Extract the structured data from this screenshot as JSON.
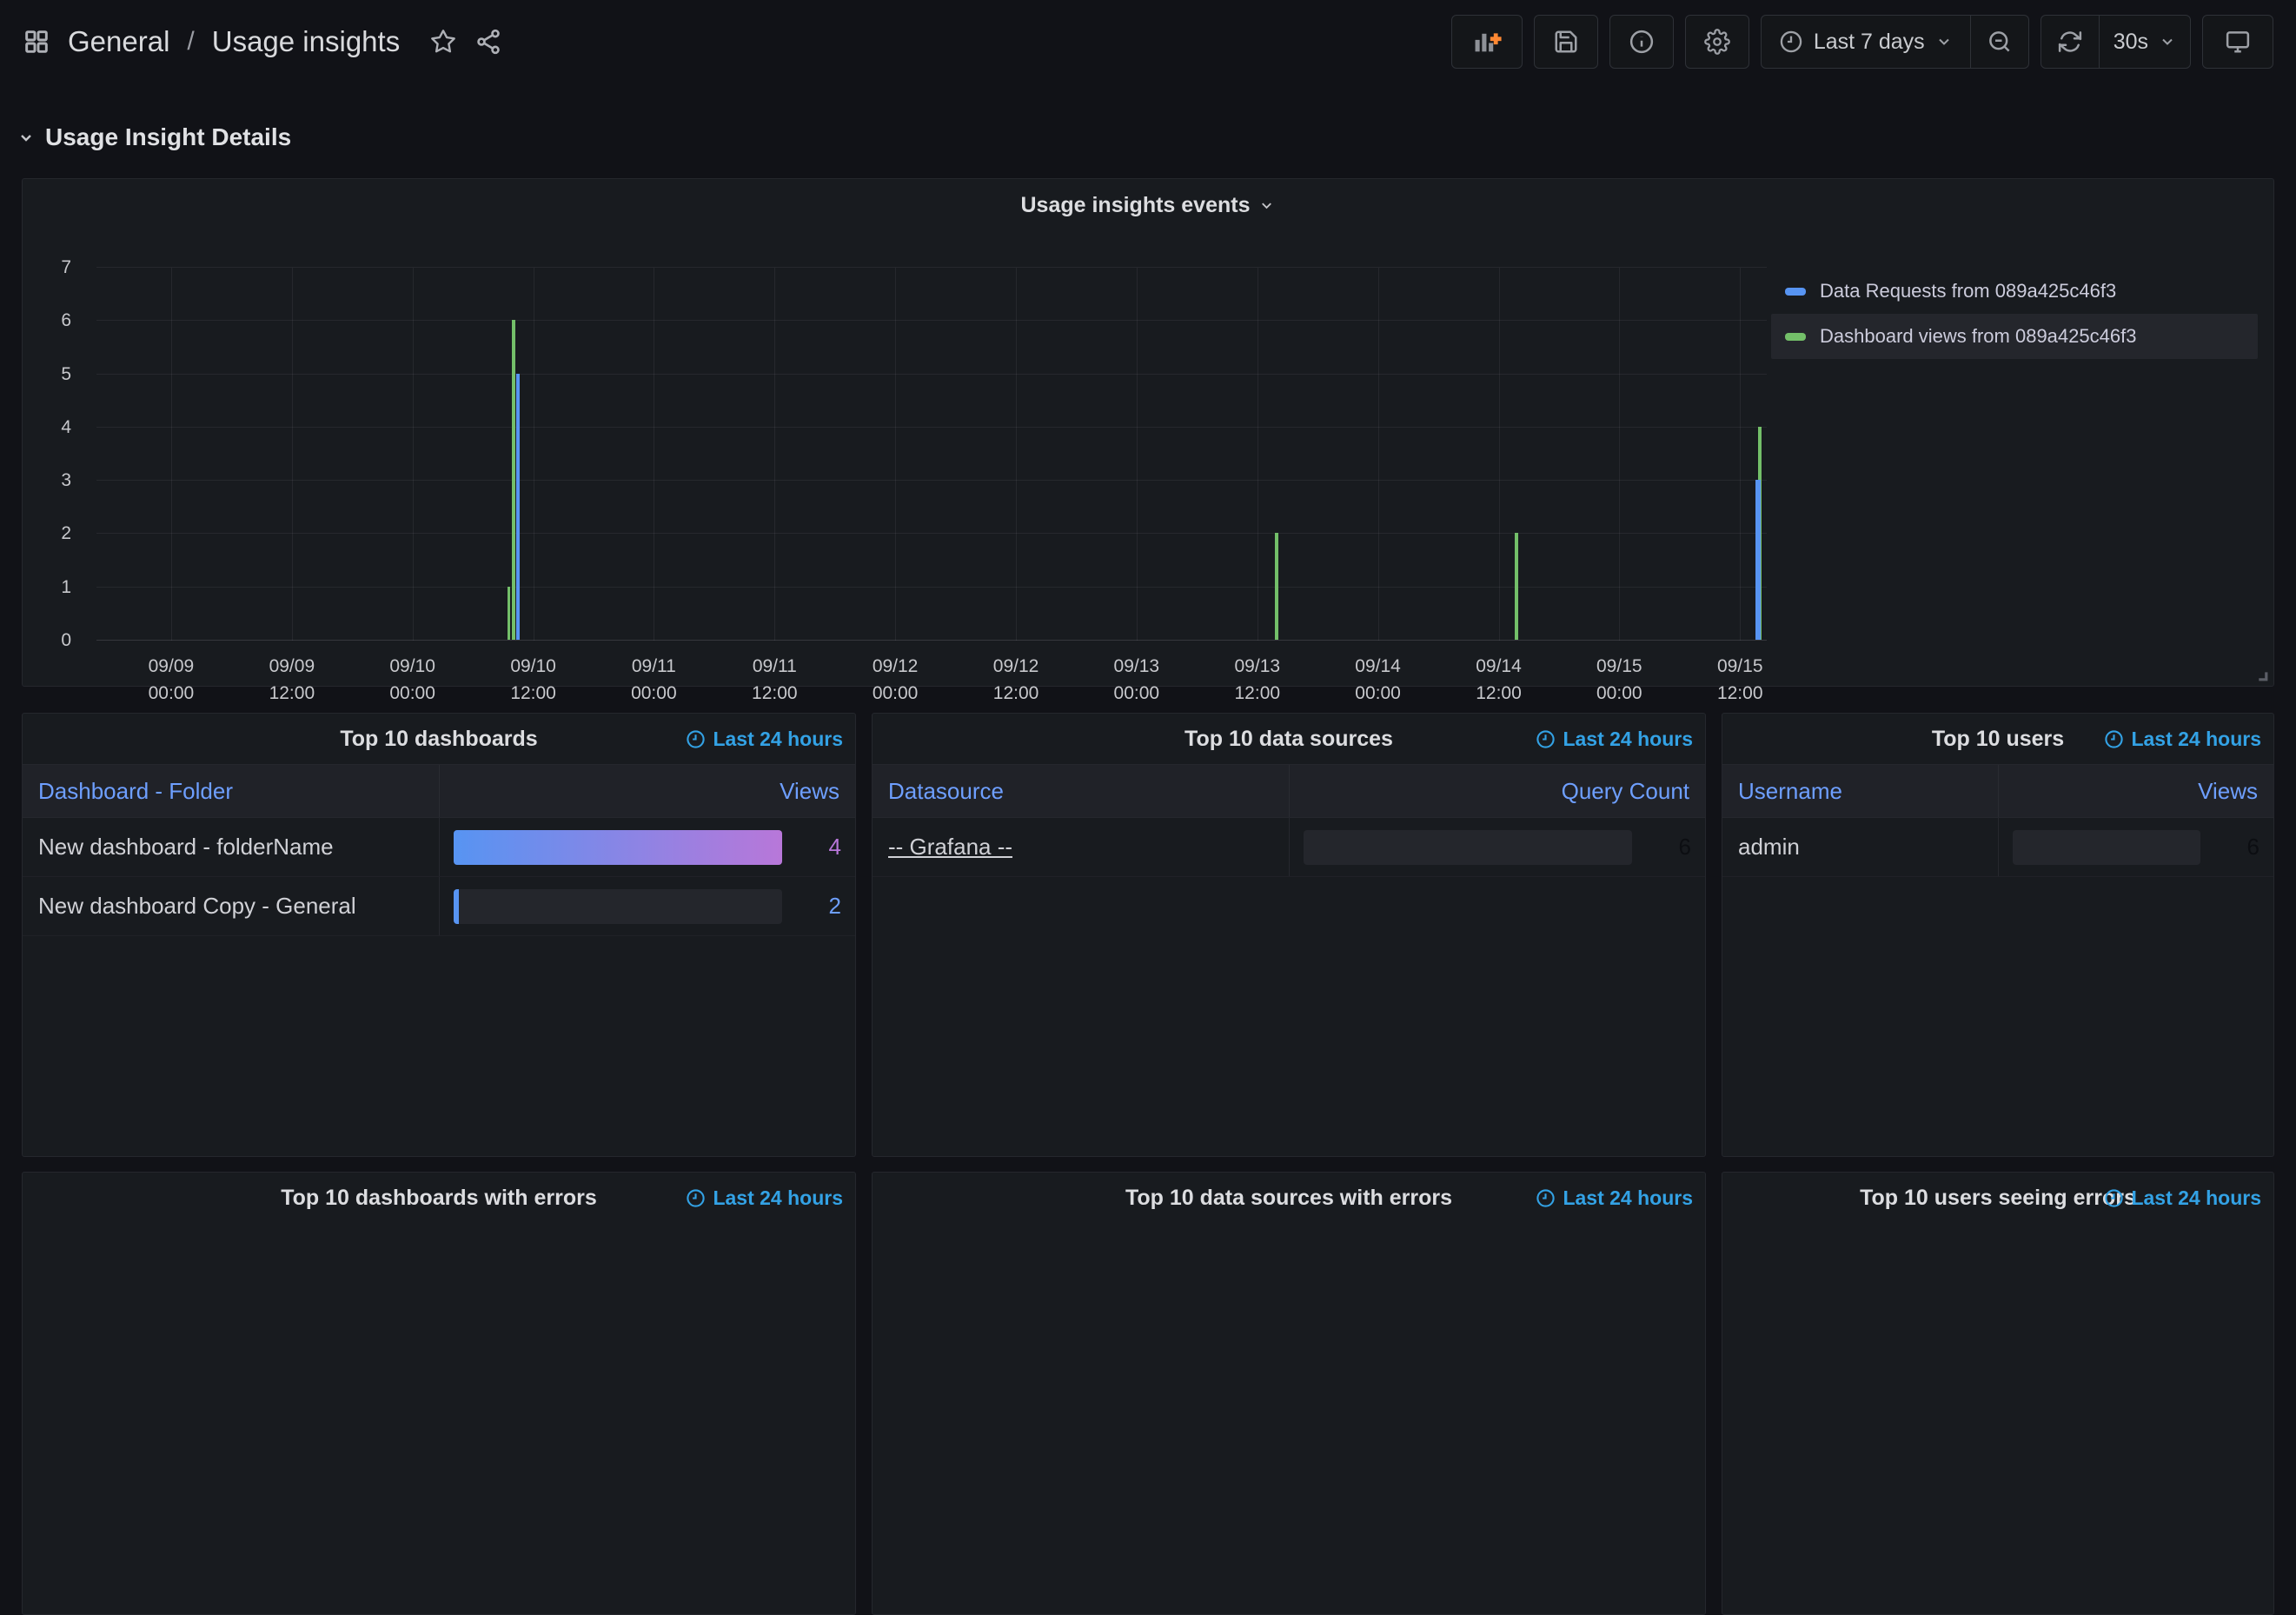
{
  "breadcrumb": {
    "section": "General",
    "separator": "/",
    "page": "Usage insights"
  },
  "toolbar": {
    "time_range_label": "Last 7 days",
    "refresh_interval": "30s"
  },
  "section_header": {
    "title": "Usage Insight Details"
  },
  "colors": {
    "data_requests": "#5794F2",
    "dashboard_views": "#73BF69",
    "gradient_start": "#5794F2",
    "gradient_end": "#B877D9",
    "accent_blue": "#33A2E5",
    "link_blue": "#6E9FFF",
    "dark_value": "#0C0E12",
    "orange_plus": "#FF8833"
  },
  "chart": {
    "title": "Usage insights events",
    "y_max": 7,
    "y_ticks": [
      7,
      6,
      5,
      4,
      3,
      2,
      1,
      0
    ],
    "x_ticks": [
      {
        "frac": 0.0447,
        "date": "09/09",
        "time": "00:00"
      },
      {
        "frac": 0.117,
        "date": "09/09",
        "time": "12:00"
      },
      {
        "frac": 0.1892,
        "date": "09/10",
        "time": "00:00"
      },
      {
        "frac": 0.2615,
        "date": "09/10",
        "time": "12:00"
      },
      {
        "frac": 0.3337,
        "date": "09/11",
        "time": "00:00"
      },
      {
        "frac": 0.406,
        "date": "09/11",
        "time": "12:00"
      },
      {
        "frac": 0.4782,
        "date": "09/12",
        "time": "00:00"
      },
      {
        "frac": 0.5505,
        "date": "09/12",
        "time": "12:00"
      },
      {
        "frac": 0.6227,
        "date": "09/13",
        "time": "00:00"
      },
      {
        "frac": 0.695,
        "date": "09/13",
        "time": "12:00"
      },
      {
        "frac": 0.7672,
        "date": "09/14",
        "time": "00:00"
      },
      {
        "frac": 0.8395,
        "date": "09/14",
        "time": "12:00"
      },
      {
        "frac": 0.9117,
        "date": "09/15",
        "time": "00:00"
      },
      {
        "frac": 0.984,
        "date": "09/15",
        "time": "12:00"
      }
    ],
    "bars": [
      {
        "frac": 0.247,
        "value": 1,
        "series": "dashboard_views",
        "w": 3
      },
      {
        "frac": 0.2497,
        "value": 6,
        "series": "dashboard_views",
        "w": 4
      },
      {
        "frac": 0.2522,
        "value": 5,
        "series": "data_requests",
        "w": 4
      },
      {
        "frac": 0.7065,
        "value": 2,
        "series": "dashboard_views",
        "w": 4
      },
      {
        "frac": 0.85,
        "value": 2,
        "series": "dashboard_views",
        "w": 4
      },
      {
        "frac": 0.996,
        "value": 4,
        "series": "dashboard_views",
        "w": 4
      },
      {
        "frac": 0.995,
        "value": 3,
        "series": "data_requests",
        "w": 6
      }
    ],
    "legend": [
      {
        "label": "Data Requests from 089a425c46f3",
        "series": "data_requests",
        "highlighted": false
      },
      {
        "label": "Dashboard views from 089a425c46f3",
        "series": "dashboard_views",
        "highlighted": true
      }
    ]
  },
  "chart_data": {
    "type": "bar",
    "title": "Usage insights events",
    "ylim": [
      0,
      7
    ],
    "x_range": [
      "09/09 00:00",
      "09/15 12:00"
    ],
    "grid": true,
    "legend_position": "right",
    "series": [
      {
        "name": "Data Requests from 089a425c46f3",
        "color": "#5794F2",
        "points": [
          {
            "x": "09/10 ~10:00",
            "y": 5
          },
          {
            "x": "09/15 ~15:00",
            "y": 3
          }
        ]
      },
      {
        "name": "Dashboard views from 089a425c46f3",
        "color": "#73BF69",
        "points": [
          {
            "x": "09/10 ~09:30",
            "y": 1
          },
          {
            "x": "09/10 ~10:00",
            "y": 6
          },
          {
            "x": "09/13 ~14:30",
            "y": 2
          },
          {
            "x": "09/14 ~14:30",
            "y": 2
          },
          {
            "x": "09/15 ~15:00",
            "y": 4
          }
        ]
      }
    ]
  },
  "tables": [
    {
      "title": "Top 10 dashboards",
      "time": "Last 24 hours",
      "columns": [
        "Dashboard - Folder",
        "Views"
      ],
      "rows": [
        {
          "label": "New dashboard - folderName",
          "link": false,
          "bar": "gradient",
          "value": "4",
          "value_color": "#B877D9"
        },
        {
          "label": "New dashboard Copy - General",
          "link": false,
          "bar": "sliver",
          "value": "2",
          "value_color": "#6E9FFF"
        }
      ]
    },
    {
      "title": "Top 10 data sources",
      "time": "Last 24 hours",
      "columns": [
        "Datasource",
        "Query Count"
      ],
      "rows": [
        {
          "label": "-- Grafana --",
          "link": true,
          "bar": "track",
          "value": "6",
          "value_color": "#0C0E12"
        }
      ]
    },
    {
      "title": "Top 10 users",
      "time": "Last 24 hours",
      "columns": [
        "Username",
        "Views"
      ],
      "rows": [
        {
          "label": "admin",
          "link": false,
          "bar": "track",
          "value": "6",
          "value_color": "#0C0E12"
        }
      ]
    }
  ],
  "bottom_panels": [
    {
      "title": "Top 10 dashboards with errors",
      "time": "Last 24 hours"
    },
    {
      "title": "Top 10 data sources with errors",
      "time": "Last 24 hours"
    },
    {
      "title": "Top 10 users seeing errors",
      "time": "Last 24 hours"
    }
  ]
}
